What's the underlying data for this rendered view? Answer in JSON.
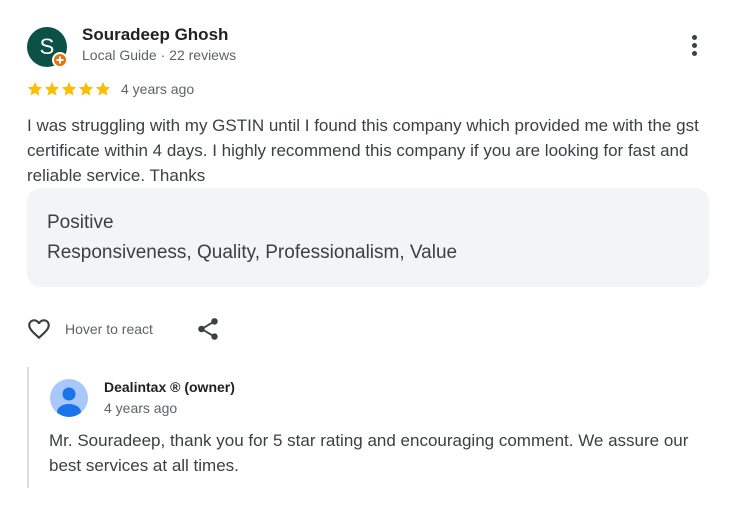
{
  "review": {
    "author": {
      "initial": "S",
      "name": "Souradeep Ghosh",
      "meta": "Local Guide · 22 reviews",
      "avatar_color": "#0b5146",
      "badge_color": "#e8710a"
    },
    "rating": 5,
    "max_rating": 5,
    "star_color": "#fbbc04",
    "date": "4 years ago",
    "text": "I was struggling with my GSTIN until I found this company which provided me with the gst certificate within 4 days. I highly recommend this company if you are looking for fast and reliable service. Thanks",
    "attributes": {
      "title": "Positive",
      "values": "Responsiveness, Quality, Professionalism, Value"
    },
    "actions": {
      "react_label": "Hover to react",
      "react_icon": "heart-outline-icon",
      "share_icon": "share-icon",
      "more_icon": "more-vert-icon"
    }
  },
  "reply": {
    "owner_name": "Dealintax ® (owner)",
    "date": "4 years ago",
    "text": "Mr. Souradeep, thank you for 5 star rating and encouraging comment. We assure our best services at all times.",
    "avatar_color": "#a8c7fa",
    "avatar_figure_color": "#1a73e8"
  }
}
